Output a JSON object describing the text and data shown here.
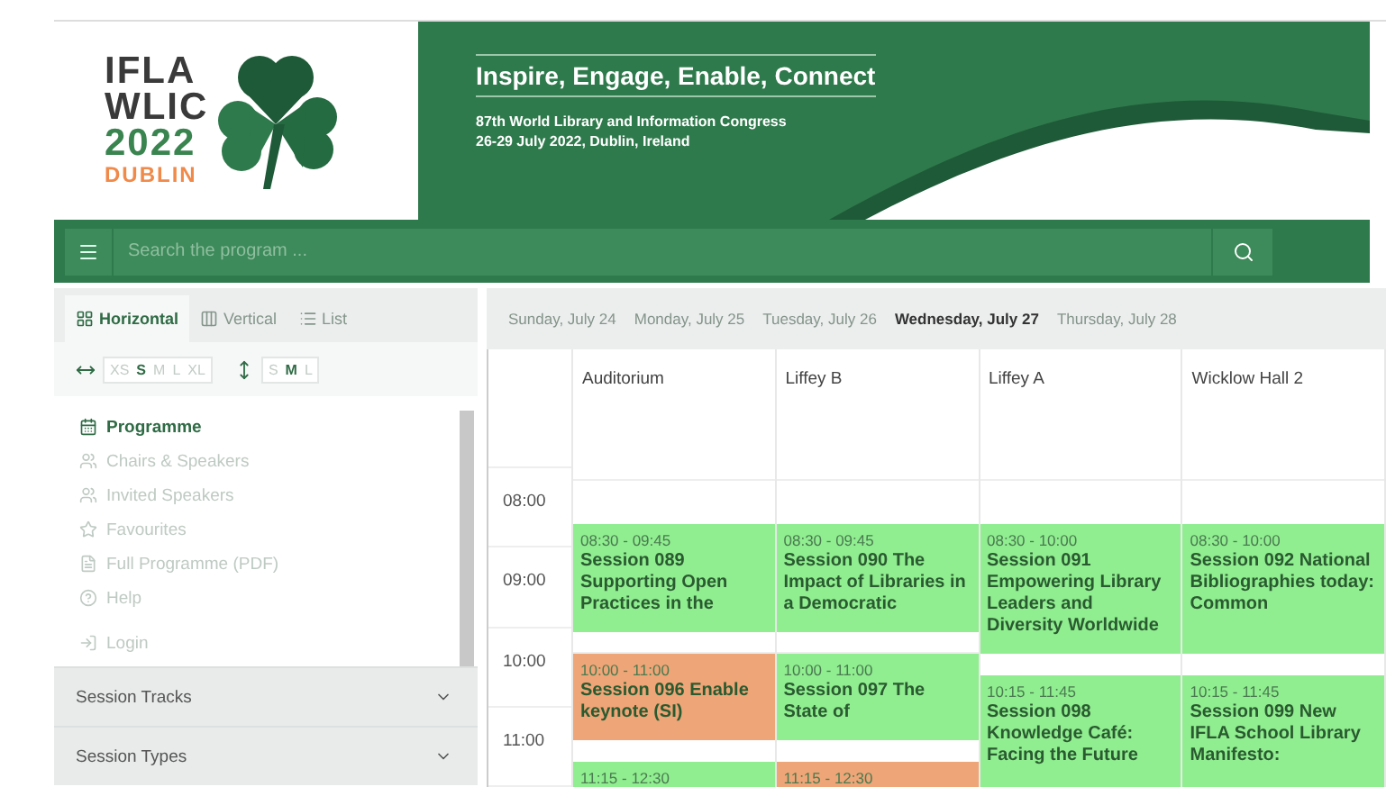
{
  "header": {
    "logo_lines": [
      "IFLA",
      "WLIC",
      "2022"
    ],
    "logo_city": "DUBLIN",
    "tagline": "Inspire, Engage, Enable, Connect",
    "subtitle_lines": [
      "87th World Library and Information Congress",
      "26-29 July 2022, Dublin, Ireland"
    ]
  },
  "search": {
    "placeholder": "Search the program ..."
  },
  "view_tabs": [
    {
      "label": "Horizontal",
      "selected": true,
      "kind": "grid"
    },
    {
      "label": "Vertical",
      "selected": false,
      "kind": "columns"
    },
    {
      "label": "List",
      "selected": false,
      "kind": "list"
    }
  ],
  "width_sizes": [
    {
      "label": "XS",
      "selected": false
    },
    {
      "label": "S",
      "selected": true
    },
    {
      "label": "M",
      "selected": false
    },
    {
      "label": "L",
      "selected": false
    },
    {
      "label": "XL",
      "selected": false
    }
  ],
  "height_sizes": [
    {
      "label": "S",
      "selected": false
    },
    {
      "label": "M",
      "selected": true
    },
    {
      "label": "L",
      "selected": false
    }
  ],
  "menu": [
    {
      "label": "Programme",
      "selected": true,
      "kind": "calendar"
    },
    {
      "label": "Chairs & Speakers",
      "selected": false,
      "kind": "users"
    },
    {
      "label": "Invited Speakers",
      "selected": false,
      "kind": "users"
    },
    {
      "label": "Favourites",
      "selected": false,
      "kind": "star"
    },
    {
      "label": "Full Programme (PDF)",
      "selected": false,
      "kind": "file"
    },
    {
      "label": "Help",
      "selected": false,
      "kind": "help"
    },
    {
      "label": "Login",
      "selected": false,
      "kind": "login"
    }
  ],
  "filters": [
    {
      "label": "Session Tracks",
      "expanded": false
    },
    {
      "label": "Session Types",
      "expanded": false
    }
  ],
  "days": [
    {
      "label": "Sunday, July 24",
      "selected": false
    },
    {
      "label": "Monday, July 25",
      "selected": false
    },
    {
      "label": "Tuesday, July 26",
      "selected": false
    },
    {
      "label": "Wednesday, July 27",
      "selected": true
    },
    {
      "label": "Thursday, July 28",
      "selected": false
    }
  ],
  "hours": [
    "08:00",
    "09:00",
    "10:00",
    "11:00"
  ],
  "rooms": [
    {
      "name": "Auditorium",
      "sessions": [
        {
          "time": "08:30 - 09:45",
          "title": "Session 089 Supporting Open Practices in the",
          "color": "#90ee90"
        },
        {
          "time": "10:00 - 11:00",
          "title": "Session 096 Enable keynote (SI)",
          "color": "#eea577"
        },
        {
          "time": "11:15 - 12:30",
          "color": "#90ee90"
        }
      ]
    },
    {
      "name": "Liffey B",
      "sessions": [
        {
          "time": "08:30 - 09:45",
          "title": "Session 090 The Impact of Libraries in a Democratic",
          "color": "#90ee90"
        },
        {
          "time": "10:00 - 11:00",
          "title": "Session 097 The State of",
          "color": "#90ee90"
        },
        {
          "time": "11:15 - 12:30",
          "color": "#eea577"
        }
      ]
    },
    {
      "name": "Liffey A",
      "sessions": [
        {
          "time": "08:30 - 10:00",
          "title": "Session 091 Empowering Library Leaders and Diversity Worldwide",
          "color": "#90ee90"
        },
        {
          "time": "10:15 - 11:45",
          "title": "Session 098 Knowledge Café: Facing the Future",
          "color": "#90ee90"
        }
      ]
    },
    {
      "name": "Wicklow Hall 2",
      "sessions": [
        {
          "time": "08:30 - 10:00",
          "title": "Session 092 National Bibliographies today: Common",
          "color": "#90ee90"
        },
        {
          "time": "10:15 - 11:45",
          "title": "Session 099 New IFLA School Library Manifesto:",
          "color": "#90ee90"
        }
      ]
    }
  ]
}
